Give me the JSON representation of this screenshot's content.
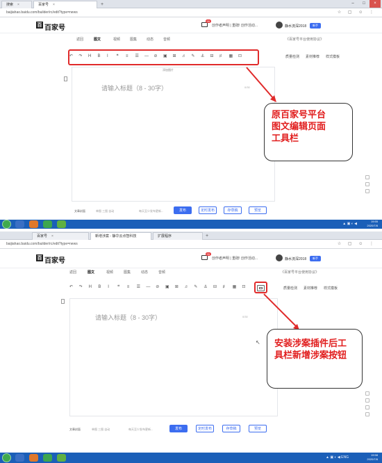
{
  "screenshot_top": {
    "tabs": [
      {
        "label": "搜索",
        "active": false
      },
      {
        "label": "百家号",
        "active": true
      }
    ],
    "url": "baijiahao.baidu.com/builder/rc/edit?type=news",
    "logo": "百家号",
    "notice": "创作者声明 | 重磅! 创作活动...",
    "username": "静水流深2018",
    "level_badge": "新手",
    "subnav": [
      "返回",
      "图文",
      "视频",
      "图集",
      "动态",
      "音频"
    ],
    "subnav_right": "《百家号平台使用协议》",
    "toolbar_icons": [
      "↶",
      "↷",
      "H",
      "B",
      "I",
      "❝",
      "≡",
      "☰",
      "—",
      "⊘",
      "▣",
      "⊞",
      "♬",
      "✎",
      "⚓",
      "⊟",
      "♯",
      "▦",
      "⊡"
    ],
    "side_links": [
      "质量检测",
      "素材推荐",
      "样式模板"
    ],
    "upload_hint": "添加图片",
    "title_placeholder": "请输入标题（8 - 30字）",
    "word_count": "0/30",
    "cover_label": "文章封面",
    "cover_options": "单图   三图   自动",
    "save_hint": "每天至少发布更新...",
    "buttons": {
      "publish": "发布",
      "schedule": "定时发布",
      "preview": "存草稿",
      "draft": "预览"
    },
    "callout": [
      "原百家号平台",
      "图文编辑页面",
      "工具栏"
    ],
    "tray_time": "19:55",
    "tray_date": "2020/7/8"
  },
  "screenshot_bottom": {
    "tabs": [
      {
        "label": "百家号",
        "active": false
      },
      {
        "label": "新增涉案 - 静华云点智科技",
        "active": true
      },
      {
        "label": "扩展程序",
        "active": false
      }
    ],
    "url": "baijiahao.baidu.com/builder/rc/edit?type=news",
    "logo": "百家号",
    "notice": "创作者声明 | 重磅! 创作活动...",
    "username": "静水流深2018",
    "level_badge": "新手",
    "subnav": [
      "返回",
      "图文",
      "视频",
      "图集",
      "动态",
      "音频"
    ],
    "subnav_right": "《百家号平台使用协议》",
    "toolbar_icons": [
      "↶",
      "↷",
      "H",
      "B",
      "I",
      "❝",
      "≡",
      "☰",
      "—",
      "⊘",
      "▣",
      "⊞",
      "♬",
      "✎",
      "⚓",
      "⊟",
      "♯",
      "▦",
      "⊡"
    ],
    "new_button_label": "涉案",
    "side_links": [
      "质量检测",
      "素材推荐",
      "样式模板"
    ],
    "title_placeholder": "请输入标题（8 - 30字）",
    "word_count": "0/30",
    "cover_label": "文章封面",
    "cover_options": "单图   三图   自动",
    "save_hint": "每天至少发布更新...",
    "buttons": {
      "publish": "发布",
      "schedule": "定时发布",
      "preview": "存草稿",
      "draft": "预览"
    },
    "callout": [
      "安装涉案插件后工",
      "具栏新增涉案按钮"
    ],
    "tray_lang": "ENG",
    "tray_time": "19:58",
    "tray_date": "2020/7/8"
  },
  "colors": {
    "highlight": "#e02a2a",
    "callout_text": "#e11d1d",
    "accent": "#3c6df0",
    "taskbar": "#1b5fb8"
  }
}
